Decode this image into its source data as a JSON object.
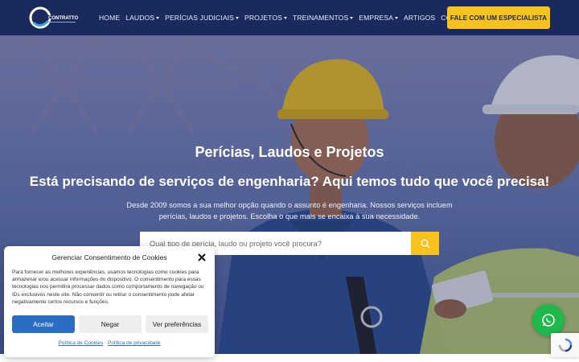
{
  "header": {
    "nav": [
      {
        "label": "HOME",
        "dropdown": false
      },
      {
        "label": "LAUDOS",
        "dropdown": true
      },
      {
        "label": "PERÍCIAS JUDICIAIS",
        "dropdown": true
      },
      {
        "label": "PROJETOS",
        "dropdown": true
      },
      {
        "label": "TREINAMENTOS",
        "dropdown": true
      },
      {
        "label": "EMPRESA",
        "dropdown": true
      },
      {
        "label": "ARTIGOS",
        "dropdown": false
      },
      {
        "label": "CONTATO",
        "dropdown": true
      }
    ],
    "cta_label": "FALE COM UM ESPECIALISTA"
  },
  "hero": {
    "title": "Perícias, Laudos e Projetos",
    "subtitle": "Está precisando de serviços de engenharia? Aqui temos tudo que você precisa!",
    "description": "Desde 2009 somos a sua melhor opção quando o assunto é engenharia. Nossos serviços incluem perícias, laudos e projetos. Escolha o que mais se encaixa à sua necessidade.",
    "search_placeholder": "Qual tipo de perícia, laudo ou projeto você procura?"
  },
  "cookie": {
    "title": "Gerenciar Consentimento de Cookies",
    "text": "Para fornecer as melhores experiências, usamos tecnologias como cookies para armazenar e/ou acessar informações do dispositivo. O consentimento para essas tecnologias nos permitirá processar dados como comportamento de navegação ou IDs exclusivos neste site. Não consentir ou retirar o consentimento pode afetar negativamente certos recursos e funções.",
    "accept": "Aceitar",
    "deny": "Negar",
    "preferences": "Ver preferências",
    "link_cookie_policy": "Política de Cookies",
    "link_privacy": "Política de privacidade"
  },
  "colors": {
    "header_bg": "#1a2a5c",
    "accent_yellow": "#f7c21b",
    "accept_blue": "#2b6cc4",
    "whatsapp_green": "#1fb84a"
  },
  "icons": [
    "logo",
    "chevron-down-icon",
    "search-icon",
    "close-icon",
    "whatsapp-icon",
    "recaptcha-icon"
  ]
}
